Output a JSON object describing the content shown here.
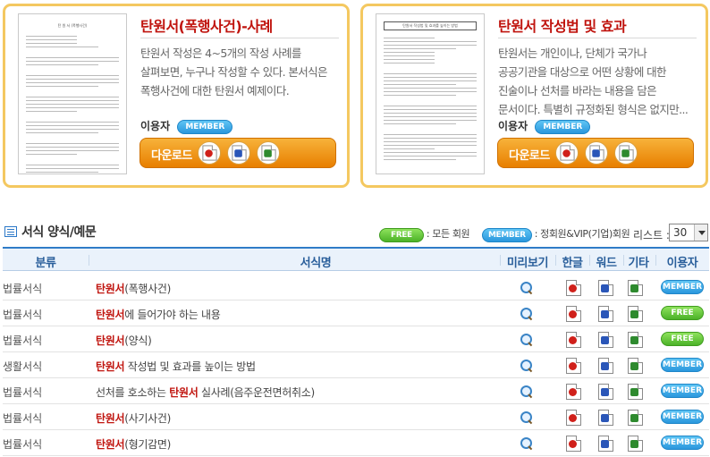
{
  "cards": [
    {
      "title": "탄원서(폭행사건)-사례",
      "desc": "탄원서 작성은 4~5개의 작성 사례를 살펴보면, 누구나 작성할 수 있다. 본서식은 폭행사건에 대한 탄원서 예제이다.",
      "user_label": "이용자",
      "badge": "MEMBER",
      "download_label": "다운로드",
      "thumb_title": "탄 원 서 (폭행사건)"
    },
    {
      "title": "탄원서 작성법 및 효과",
      "desc": "탄원서는 개인이나, 단체가 국가나 공공기관을 대상으로 어떤 상황에 대한 진술이나 선처를 바라는 내용을 담은 문서이다. 특별히 규정화된 형식은 없지만...",
      "user_label": "이용자",
      "badge": "MEMBER",
      "download_label": "다운로드",
      "thumb_title": "탄원서 작성법 및 효과를 높이는 방법"
    }
  ],
  "section": {
    "title": "서식 양식/예문",
    "legend_free_badge": "FREE",
    "legend_free_text": ": 모든 회원",
    "legend_member_badge": "MEMBER",
    "legend_member_text": ": 정회원&VIP(기업)회원",
    "list_label": "리스트 :",
    "list_value": "30"
  },
  "table": {
    "headers": [
      "분류",
      "서식명",
      "미리보기",
      "한글",
      "워드",
      "기타",
      "이용자"
    ],
    "rows": [
      {
        "cat": "법률서식",
        "pre": "",
        "hl": "탄원서",
        "post": "(폭행사건)",
        "badge": "MEMBER"
      },
      {
        "cat": "법률서식",
        "pre": "",
        "hl": "탄원서",
        "post": "에 들어가야 하는 내용",
        "badge": "FREE"
      },
      {
        "cat": "법률서식",
        "pre": "",
        "hl": "탄원서",
        "post": "(양식)",
        "badge": "FREE"
      },
      {
        "cat": "생활서식",
        "pre": "",
        "hl": "탄원서",
        "post": " 작성법 및 효과를 높이는 방법",
        "badge": "MEMBER"
      },
      {
        "cat": "법률서식",
        "pre": "선처를 호소하는 ",
        "hl": "탄원서",
        "post": " 실사례(음주운전면허취소)",
        "badge": "MEMBER"
      },
      {
        "cat": "법률서식",
        "pre": "",
        "hl": "탄원서",
        "post": "(사기사건)",
        "badge": "MEMBER"
      },
      {
        "cat": "법률서식",
        "pre": "",
        "hl": "탄원서",
        "post": "(형기감면)",
        "badge": "MEMBER"
      }
    ]
  },
  "colors": {
    "accent_red": "#c0140e",
    "card_border": "#f4c860",
    "download_orange": "#e87f00",
    "header_blue": "#2f7cc8",
    "member_badge": "#2a97dd",
    "free_badge": "#4cb228"
  },
  "icons": {
    "preview": "magnifier-icon",
    "hangul": "hwp-file-icon",
    "word": "word-file-icon",
    "other": "excel-file-icon",
    "section": "list-icon"
  }
}
